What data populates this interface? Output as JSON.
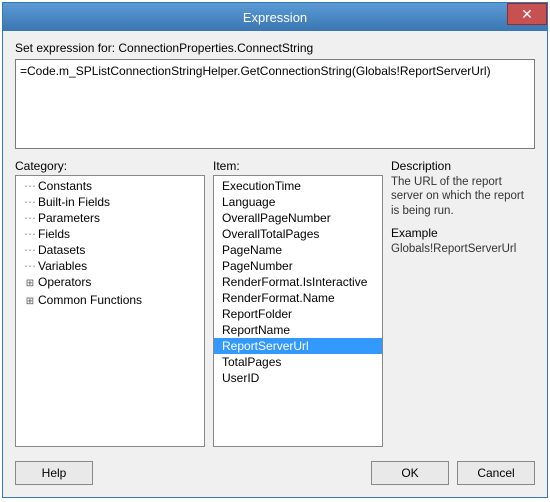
{
  "window": {
    "title": "Expression",
    "close_glyph": "✕"
  },
  "labels": {
    "set_expression_for": "Set expression for: ConnectionProperties.ConnectString",
    "category": "Category:",
    "item": "Item:",
    "description": "Description",
    "example": "Example"
  },
  "expression": {
    "value": "=Code.m_SPListConnectionStringHelper.GetConnectionString(Globals!ReportServerUrl)"
  },
  "category_tree": [
    {
      "label": "Constants",
      "expandable": false
    },
    {
      "label": "Built-in Fields",
      "expandable": false
    },
    {
      "label": "Parameters",
      "expandable": false
    },
    {
      "label": "Fields",
      "expandable": false
    },
    {
      "label": "Datasets",
      "expandable": false
    },
    {
      "label": "Variables",
      "expandable": false
    },
    {
      "label": "Operators",
      "expandable": true,
      "expander": "⊞"
    },
    {
      "label": "Common Functions",
      "expandable": true,
      "expander": "⊞"
    }
  ],
  "items": [
    "ExecutionTime",
    "Language",
    "OverallPageNumber",
    "OverallTotalPages",
    "PageName",
    "PageNumber",
    "RenderFormat.IsInteractive",
    "RenderFormat.Name",
    "ReportFolder",
    "ReportName",
    "ReportServerUrl",
    "TotalPages",
    "UserID"
  ],
  "selected_item_index": 10,
  "description_text": "The URL of the report server on which the report is being run.",
  "example_text": "Globals!ReportServerUrl",
  "buttons": {
    "help": "Help",
    "ok": "OK",
    "cancel": "Cancel"
  }
}
